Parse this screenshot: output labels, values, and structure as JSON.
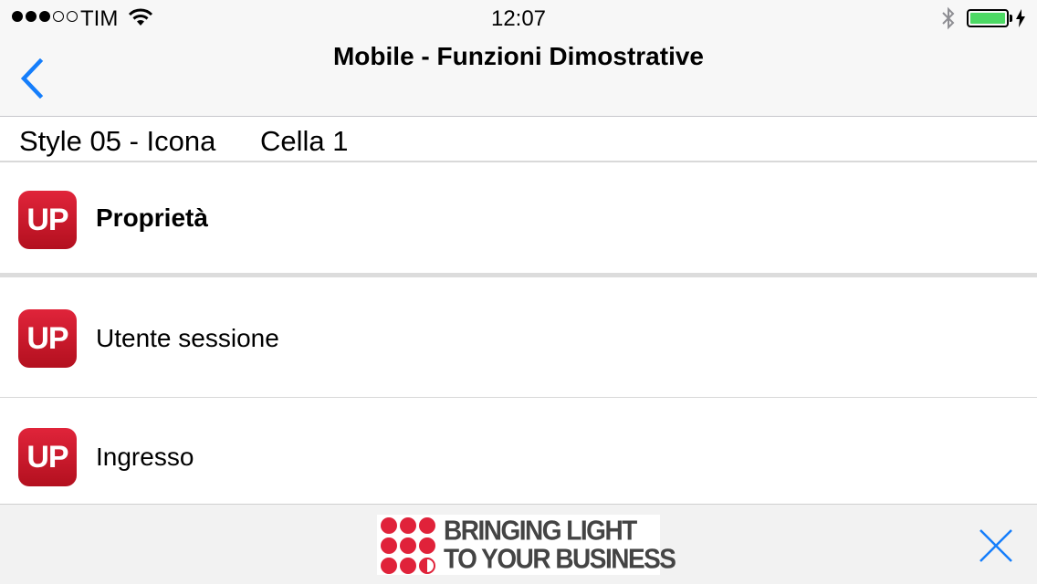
{
  "status_bar": {
    "carrier": "TIM",
    "time": "12:07",
    "signal_bars_filled": 3,
    "signal_bars_total": 5,
    "battery_level": 1.0,
    "battery_color": "#4cd964",
    "charging": true,
    "icons": [
      "wifi-icon",
      "bluetooth-icon",
      "battery-icon",
      "charging-bolt-icon"
    ]
  },
  "nav": {
    "title": "Mobile - Funzioni Dimostrative",
    "back_icon": "chevron-left-icon",
    "accent_color": "#157efb"
  },
  "section": {
    "title": "Style 05 - Icona",
    "subtitle": "Cella 1"
  },
  "list": {
    "items": [
      {
        "icon_text": "UP",
        "label": "Proprietà"
      },
      {
        "icon_text": "UP",
        "label": "Utente sessione"
      },
      {
        "icon_text": "UP",
        "label": "Ingresso"
      }
    ],
    "icon_color": "#d01b2e"
  },
  "ad": {
    "line1": "BRINGING LIGHT",
    "line2": "TO YOUR BUSINESS",
    "brand_color": "#e0223a",
    "close_icon": "close-x-icon"
  }
}
